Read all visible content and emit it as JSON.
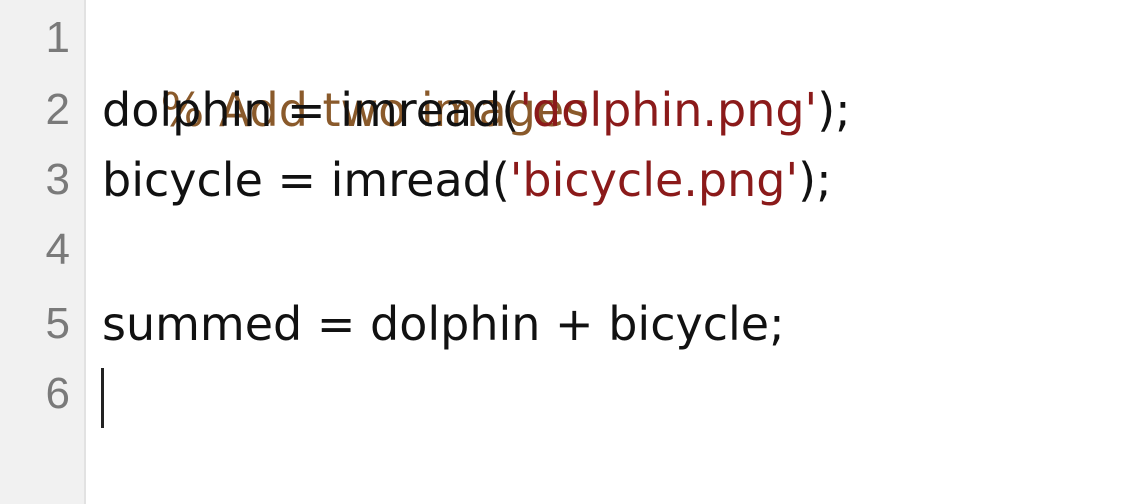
{
  "editor": {
    "lines": [
      {
        "number": "1",
        "comment": "% Add two images"
      },
      {
        "number": "2",
        "code_before": "dolphin = imread(",
        "string": "'dolphin.png'",
        "code_after": ");"
      },
      {
        "number": "3",
        "code_before": "bicycle = imread(",
        "string": "'bicycle.png'",
        "code_after": ");"
      },
      {
        "number": "4",
        "code": ""
      },
      {
        "number": "5",
        "code": "summed = dolphin + bicycle;"
      },
      {
        "number": "6",
        "code": ""
      }
    ],
    "colors": {
      "comment": "#8a5a2b",
      "string": "#8b1a1a",
      "code": "#111111",
      "line_number": "#7a7a7a",
      "gutter": "#f1f1f1"
    }
  }
}
